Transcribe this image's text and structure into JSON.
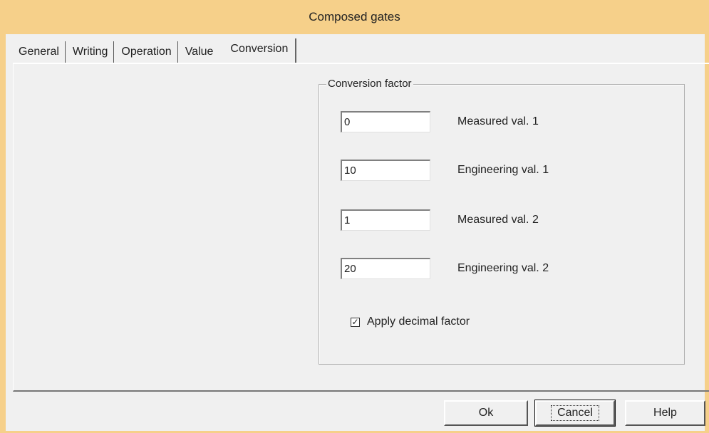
{
  "window": {
    "title": "Composed gates"
  },
  "tabs": [
    {
      "label": "General"
    },
    {
      "label": "Writing"
    },
    {
      "label": "Operation"
    },
    {
      "label": "Value"
    },
    {
      "label": "Conversion",
      "active": true
    }
  ],
  "conversion": {
    "group_title": "Conversion factor",
    "fields": [
      {
        "value": "0",
        "label": "Measured val. 1"
      },
      {
        "value": "10",
        "label": "Engineering val. 1"
      },
      {
        "value": "1",
        "label": "Measured val. 2"
      },
      {
        "value": "20",
        "label": "Engineering val. 2"
      }
    ],
    "apply_decimal": {
      "label": "Apply decimal factor",
      "checked": true
    }
  },
  "buttons": {
    "ok": "Ok",
    "cancel": "Cancel",
    "help": "Help"
  },
  "colors": {
    "titlebar": "#f6d08a",
    "face": "#f0f0f0"
  }
}
